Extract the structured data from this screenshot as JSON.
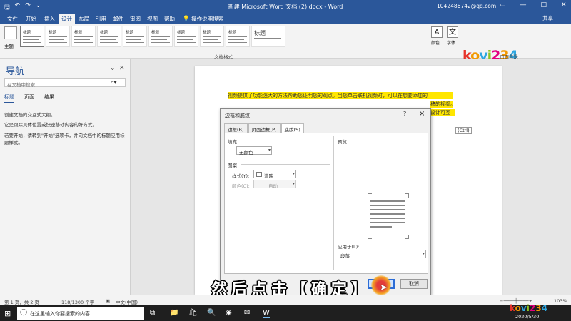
{
  "titlebar": {
    "qa_icons": [
      "save-icon",
      "undo-icon",
      "redo-icon",
      "customize-icon"
    ],
    "doc_title": "新建 Microsoft Word 文档 (2).docx  -  Word",
    "account": "1042486742@qq.com",
    "win_controls": [
      "ribbon-display-icon",
      "minimize-icon",
      "maximize-icon",
      "close-icon"
    ]
  },
  "menu": {
    "tabs": [
      "文件",
      "开始",
      "插入",
      "设计",
      "布局",
      "引用",
      "邮件",
      "审阅",
      "视图",
      "帮助"
    ],
    "active_tab": "设计",
    "tell_me": "操作说明搜索",
    "share": "共享"
  },
  "ribbon": {
    "theme_label": "主题",
    "style_headings": [
      "标题",
      "标题",
      "标题",
      "标题",
      "标题",
      "标题",
      "标题",
      "标题",
      "标题",
      "标题"
    ],
    "group_label": "文档格式",
    "right_items": [
      {
        "glyph": "A",
        "label": "颜色"
      },
      {
        "glyph": "文",
        "label": "字体"
      }
    ],
    "page_bg_label": "页面背景",
    "watermark_logo": "kovi234"
  },
  "nav": {
    "title": "导航",
    "search_placeholder": "在文档中搜索",
    "tabs": [
      "标题",
      "页面",
      "结果"
    ],
    "active_tab": "标题",
    "paragraphs": [
      "创建文档的交互式大纲。",
      "它是跟踪具体位置或快速移动内容的好方式。",
      "若要开始，请转到\"开始\"选项卡，并向文档中的标题应用标题样式。"
    ]
  },
  "document": {
    "line1": "视频提供了功能强大的方法帮助您证明您的观点。当您单击联机视频时，可以在想要添加的",
    "line2": "稿的视频。",
    "line3": "设计可互",
    "ctrl_tag": "(Ctrl)"
  },
  "dialog": {
    "title": "边框和底纹",
    "help": "?",
    "close": "×",
    "tabs": [
      "边框(B)",
      "页面边框(P)",
      "底纹(S)"
    ],
    "active_tab": "底纹(S)",
    "fill_label": "填充",
    "fill_value": "无颜色",
    "pattern_label": "图案",
    "style_label": "样式(Y):",
    "style_value": "清除",
    "color_label": "颜色(C):",
    "color_value": "自动",
    "preview_label": "预览",
    "apply_label": "应用于(L):",
    "apply_value": "段落",
    "ok_label": "确定",
    "cancel_label": "取消"
  },
  "subtitle": "然后点击【确定】",
  "status": {
    "page": "第 1 页，共 2 页",
    "words": "118/1300 个字",
    "lang": "中文(中国)",
    "zoom": "103%"
  },
  "taskbar": {
    "search_placeholder": "在这里输入你要搜索的内容",
    "date": "2020/5/30",
    "apps": [
      "task-view-icon",
      "folder-icon",
      "store-icon",
      "search-app-icon",
      "chrome-icon",
      "mail-icon",
      "word-icon"
    ]
  }
}
